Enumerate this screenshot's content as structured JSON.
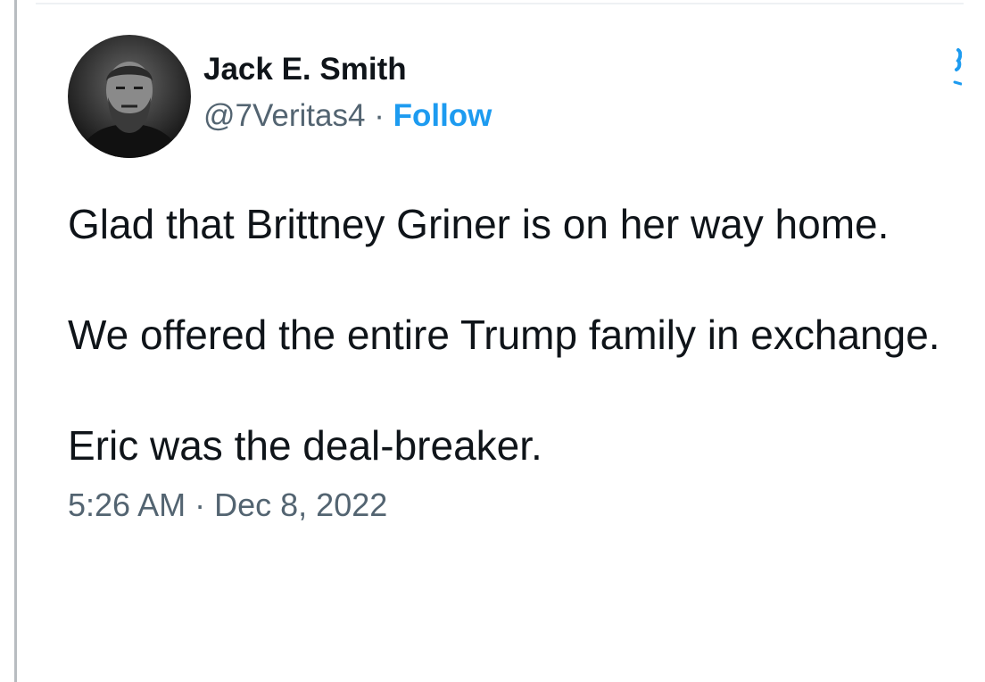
{
  "tweet": {
    "display_name": "Jack E. Smith",
    "handle": "@7Veritas4",
    "separator": "·",
    "follow_label": "Follow",
    "paragraphs": [
      "Glad that Brittney Griner is on her way home.",
      "We offered the entire Trump family in exchange.",
      "Eric was the deal-breaker."
    ],
    "time": "5:26 AM",
    "date_separator": "·",
    "date": "Dec 8, 2022"
  },
  "colors": {
    "accent": "#1d9bf0",
    "text": "#0f1419",
    "secondary": "#536471"
  },
  "icons": {
    "avatar": "profile-photo",
    "brand": "twitter-bird-icon"
  }
}
